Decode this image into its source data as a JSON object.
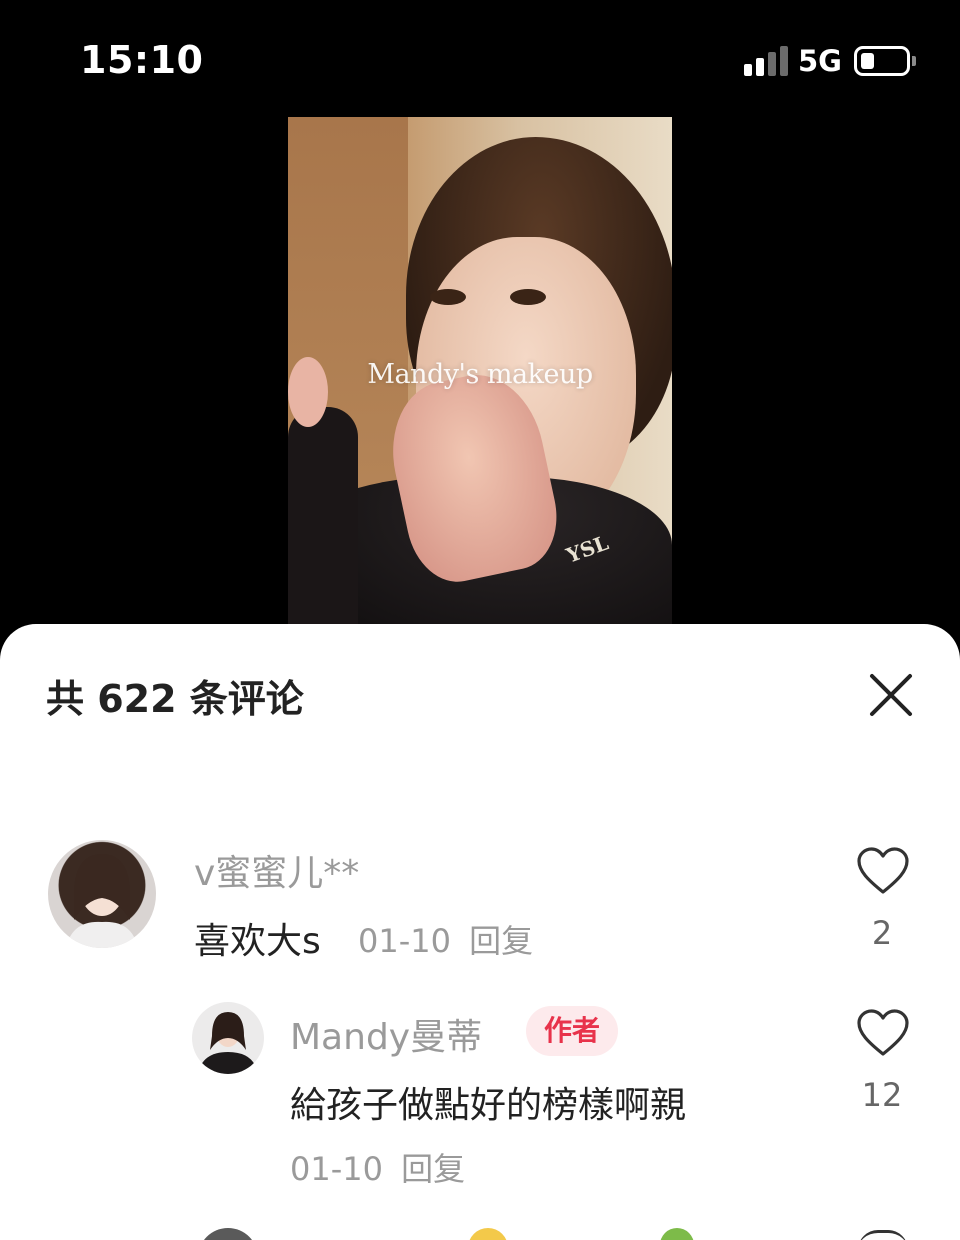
{
  "status_bar": {
    "time": "15:10",
    "network": "5G",
    "battery_level": 0.3,
    "signal_bars_active": 2,
    "signal_bars_total": 4
  },
  "video": {
    "caption": "Mandy's makeup",
    "logo_text": "YSL"
  },
  "comments_panel": {
    "title": "共 622 条评论",
    "comments": [
      {
        "username": "v蜜蜜儿**",
        "text": "喜欢大s",
        "date": "01-10",
        "reply_label": "回复",
        "likes": "2"
      },
      {
        "username": "Mandy曼蒂",
        "badge": "作者",
        "text": "給孩子做點好的榜樣啊親",
        "date": "01-10",
        "reply_label": "回复",
        "likes": "12"
      }
    ]
  },
  "colors": {
    "author_badge_bg": "#fdeaec",
    "author_badge_text": "#e8334b",
    "secondary_text": "#9a9a9a"
  }
}
